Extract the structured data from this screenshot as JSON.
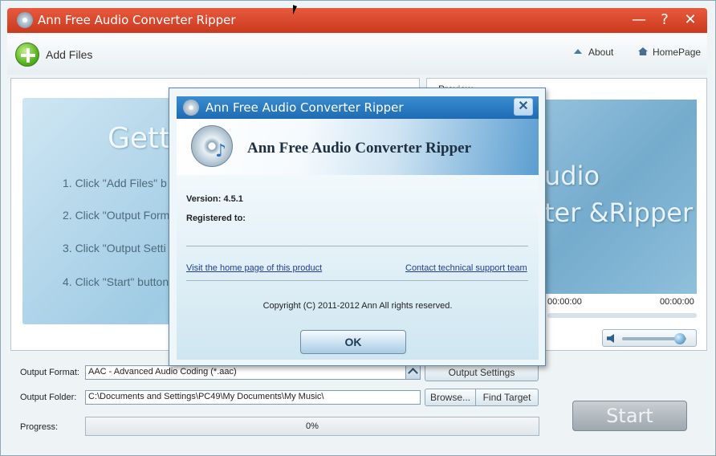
{
  "window": {
    "title": "Ann Free Audio Converter Ripper",
    "minimize_glyph": "—",
    "help_glyph": "?",
    "close_glyph": "✕"
  },
  "toolbar": {
    "add_files_label": "Add Files",
    "about_label": "About",
    "homepage_label": "HomePage"
  },
  "getting_started": {
    "title": "Gett",
    "steps": [
      "1. Click \"Add Files\" b",
      "2. Click \"Output Form",
      "3. Click \"Output Setti",
      "4. Click \"Start\" button"
    ]
  },
  "preview": {
    "label": "Preview",
    "text_line1": "udio",
    "text_line2": "ter &Ripper",
    "time_current": "00:00:00",
    "time_total": "00:00:00",
    "volume_level": 0.9
  },
  "output": {
    "format_label": "Output Format:",
    "format_value": "AAC - Advanced Audio Coding (*.aac)",
    "settings_button": "Output Settings",
    "folder_label": "Output Folder:",
    "folder_value": "C:\\Documents and Settings\\PC49\\My Documents\\My Music\\",
    "browse_button": "Browse...",
    "find_target_button": "Find Target",
    "progress_label": "Progress:",
    "progress_value": "0%",
    "start_button": "Start"
  },
  "about_dialog": {
    "title": "Ann Free Audio Converter Ripper",
    "banner_title": "Ann Free Audio Converter Ripper",
    "version": "Version: 4.5.1",
    "registered": "Registered to:",
    "home_link": "Visit the home page of this product",
    "support_link": "Contact technical support team",
    "copyright": "Copyright (C) 2011-2012 Ann All rights reserved.",
    "ok_button": "OK",
    "close_glyph": "✕"
  },
  "colors": {
    "title_bar": "#d9482b",
    "dialog_title_bar": "#2a7bc4",
    "link": "#1f3d9c"
  }
}
